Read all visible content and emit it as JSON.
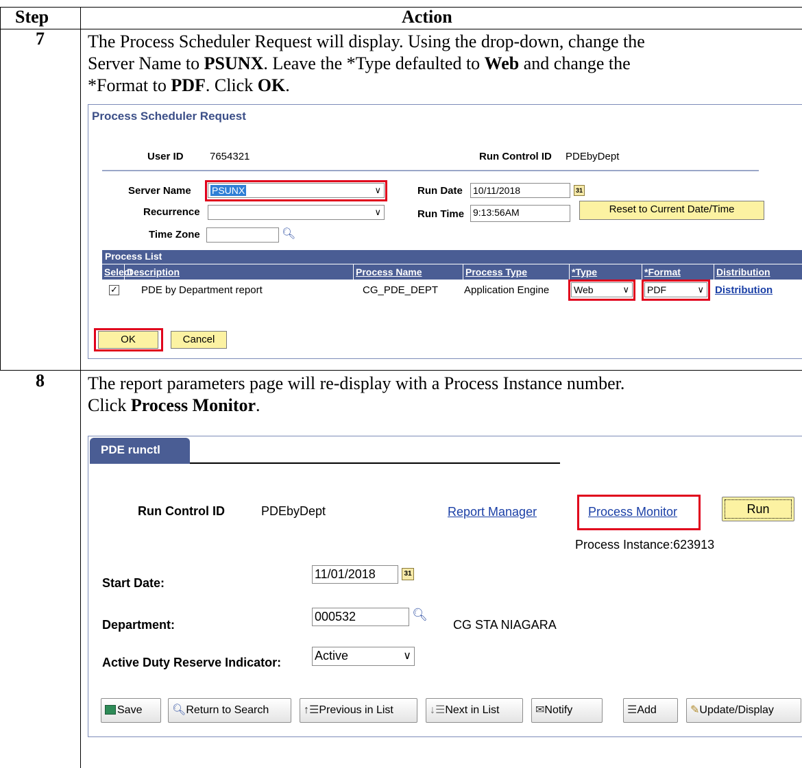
{
  "header": {
    "step": "Step",
    "action": "Action"
  },
  "step7": {
    "number": "7",
    "line1": "The Process Scheduler Request will display.  Using the drop-down, change the",
    "line2_a": "Server Name to ",
    "line2_b": "PSUNX",
    "line2_c": ".  Leave the *Type defaulted to ",
    "line2_d": "Web",
    "line2_e": " and change the",
    "line3_a": "*Format to ",
    "line3_b": "PDF",
    "line3_c": ".  Click ",
    "line3_d": "OK",
    "line3_e": ".",
    "screen": {
      "title": "Process Scheduler Request",
      "user_id_label": "User ID",
      "user_id_value": "7654321",
      "run_control_label": "Run Control ID",
      "run_control_value": "PDEbyDept",
      "server_name_label": "Server Name",
      "server_name_value": "PSUNX",
      "recurrence_label": "Recurrence",
      "recurrence_value": "",
      "time_zone_label": "Time Zone",
      "time_zone_value": "",
      "run_date_label": "Run Date",
      "run_date_value": "10/11/2018",
      "run_time_label": "Run Time",
      "run_time_value": "9:13:56AM",
      "reset_button": "Reset to Current Date/Time",
      "process_list_title": "Process List",
      "columns": [
        "Select",
        "Description",
        "Process Name",
        "Process Type",
        "*Type",
        "*Format",
        "Distribution"
      ],
      "row": {
        "checked": "✓",
        "description": "PDE by Department report",
        "process_name": "CG_PDE_DEPT",
        "process_type": "Application Engine",
        "type": "Web",
        "format": "PDF",
        "distribution": "Distribution"
      },
      "ok_button": "OK",
      "cancel_button": "Cancel"
    }
  },
  "step8": {
    "number": "8",
    "line1": "The report parameters page will re-display with a Process Instance number.",
    "line2_a": "Click ",
    "line2_b": "Process Monitor",
    "line2_c": ".",
    "screen": {
      "tab": "PDE runctl",
      "run_control_label": "Run Control ID",
      "run_control_value": "PDEbyDept",
      "report_manager_link": "Report Manager",
      "process_monitor_link": "Process Monitor",
      "run_button": "Run",
      "process_instance": "Process Instance:623913",
      "start_date_label": "Start Date:",
      "start_date_value": "11/01/2018",
      "department_label": "Department:",
      "department_value": "000532",
      "department_name": "CG STA NIAGARA",
      "adri_label": "Active Duty Reserve Indicator:",
      "adri_value": "Active",
      "toolbar": {
        "save": "Save",
        "return_to_search": "Return to Search",
        "previous_in_list": "Previous in List",
        "next_in_list": "Next in List",
        "notify": "Notify",
        "add": "Add",
        "update_display": "Update/Display"
      }
    }
  },
  "colors": {
    "header_blue": "#4a5d94",
    "link_blue": "#1a3fa6",
    "highlight_red": "#e0001b",
    "button_yellow": "#fcf2a2"
  }
}
